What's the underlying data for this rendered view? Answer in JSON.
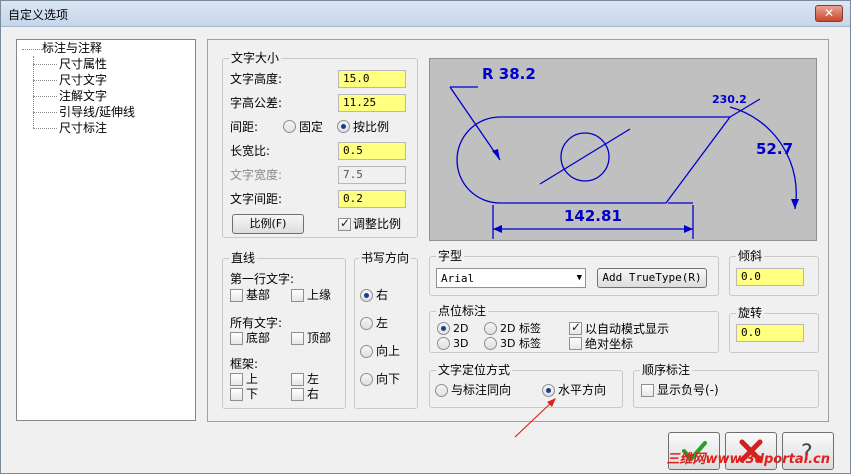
{
  "window": {
    "title": "自定义选项",
    "close_label": "✕"
  },
  "tree": {
    "root": "标注与注释",
    "children": [
      "尺寸属性",
      "尺寸文字",
      "注解文字",
      "引导线/延伸线",
      "尺寸标注"
    ]
  },
  "text_size": {
    "title": "文字大小",
    "height_label": "文字高度:",
    "height_value": "15.0",
    "tolerance_label": "字高公差:",
    "tolerance_value": "11.25",
    "spacing_label": "间距:",
    "spacing_fixed": "固定",
    "spacing_ratio": "按比例",
    "aspect_label": "长宽比:",
    "aspect_value": "0.5",
    "width_label": "文字宽度:",
    "width_value": "7.5",
    "char_spacing_label": "文字间距:",
    "char_spacing_value": "0.2",
    "scale_button": "比例(F)",
    "adjust_scale_label": "调整比例"
  },
  "preview": {
    "radius_label": "R 38.2",
    "angle_label": "230.2",
    "vertical_label": "52.7",
    "horizontal_label": "142.81"
  },
  "lines": {
    "title": "直线",
    "first_line_label": "第一行文字:",
    "base": "基部",
    "top": "上缘",
    "all_text_label": "所有文字:",
    "bottom": "底部",
    "top2": "顶部",
    "frame_label": "框架:",
    "frame_top": "上",
    "frame_left": "左",
    "frame_bottom": "下",
    "frame_right": "右"
  },
  "direction": {
    "title": "书写方向",
    "options": [
      "右",
      "左",
      "向上",
      "向下"
    ]
  },
  "font": {
    "title": "字型",
    "value": "Arial",
    "add_button": "Add TrueType(R)"
  },
  "slant": {
    "title": "倾斜",
    "value": "0.0"
  },
  "point": {
    "title": "点位标注",
    "o1": "2D",
    "o2": "2D 标签",
    "o3": "3D",
    "o4": "3D 标签",
    "auto_mode": "以自动模式显示",
    "absolute": "绝对坐标"
  },
  "rotate": {
    "title": "旋转",
    "value": "0.0"
  },
  "position": {
    "title": "文字定位方式",
    "along": "与标注同向",
    "horizontal": "水平方向"
  },
  "ordinate": {
    "title": "顺序标注",
    "show_negative": "显示负号(-)"
  },
  "watermark": "三维网www.3dportal.cn",
  "colors": {
    "accent": "#ffff80",
    "ok_green": "#2aa02a",
    "cancel_red": "#d02020"
  }
}
